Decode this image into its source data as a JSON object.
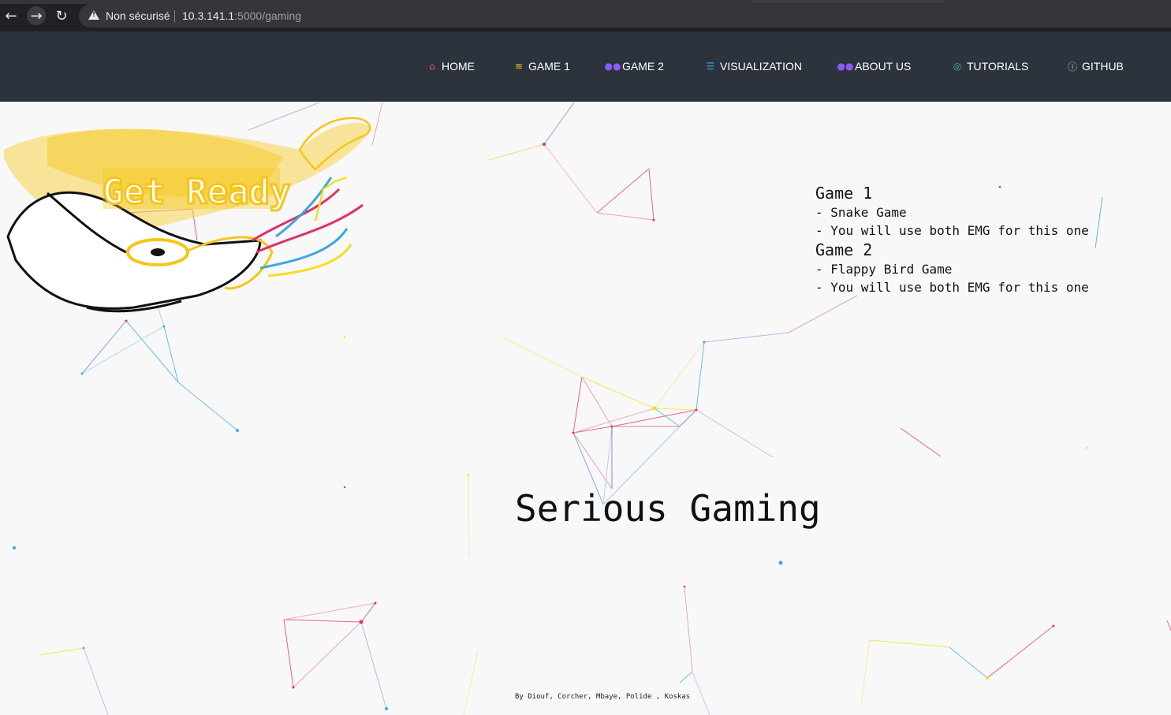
{
  "browser": {
    "security_label": "Non sécurisé",
    "url_host": "10.3.141.1",
    "url_rest": ":5000/gaming",
    "back_icon": "back-arrow-icon",
    "forward_icon": "forward-arrow-icon",
    "reload_icon": "reload-icon"
  },
  "navbar": {
    "items": [
      {
        "label": "HOME",
        "icon": "home-icon",
        "icon_color": "#e85a5a"
      },
      {
        "label": "GAME 1",
        "icon": "layers-icon",
        "icon_color": "#f0c028"
      },
      {
        "label": "GAME 2",
        "icon": "users-icon",
        "icon_color": "#8a5cf6"
      },
      {
        "label": "VISUALIZATION",
        "icon": "bars-icon",
        "icon_color": "#3fa0e8"
      },
      {
        "label": "ABOUT US",
        "icon": "users-icon",
        "icon_color": "#8a5cf6"
      },
      {
        "label": "TUTORIALS",
        "icon": "headset-icon",
        "icon_color": "#2fbf9f"
      },
      {
        "label": "GITHUB",
        "icon": "info-circle-icon",
        "icon_color": "#cccccc"
      }
    ]
  },
  "hero": {
    "banner_text": "Get Ready",
    "games": [
      {
        "title": "Game 1",
        "lines": [
          "- Snake Game",
          "- You will use both EMG for this one"
        ]
      },
      {
        "title": "Game 2",
        "lines": [
          "- Flappy Bird Game",
          "- You will use both EMG for this one"
        ]
      }
    ],
    "title": "Serious Gaming",
    "credits": "By Diouf, Corcher, Mbaye, Polide , Koskas"
  },
  "colors": {
    "navbar_bg": "#2d333d",
    "page_bg": "#f8f8f8",
    "particle_pink": "#e0306a",
    "particle_blue": "#3aa8e0",
    "particle_yellow": "#f0e020",
    "banner_yellow": "#f5c518"
  }
}
